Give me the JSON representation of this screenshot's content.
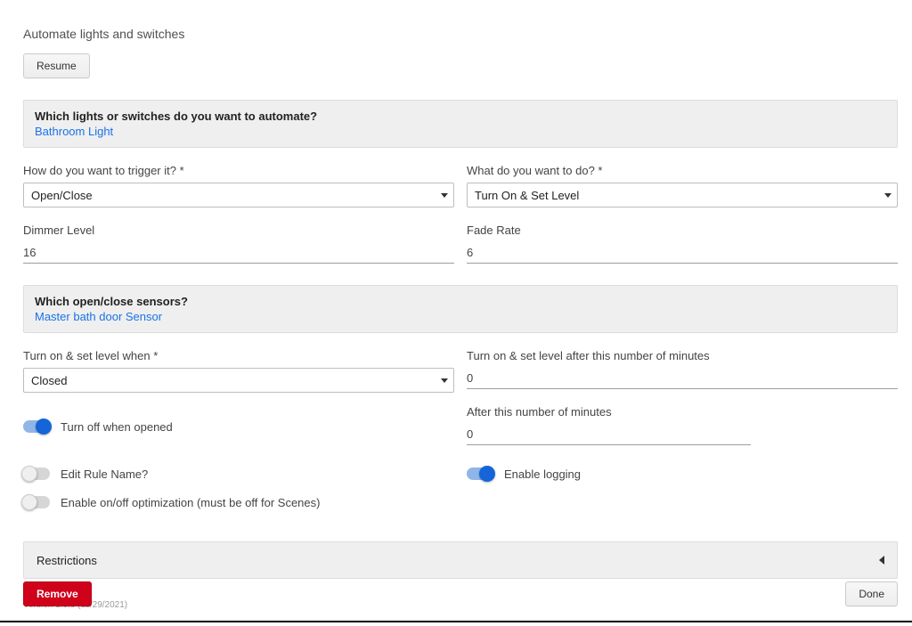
{
  "title": "Automate lights and switches",
  "resume_label": "Resume",
  "lights_panel": {
    "question": "Which lights or switches do you want to automate?",
    "selected": "Bathroom Light"
  },
  "trigger": {
    "label": "How do you want to trigger it? *",
    "value": "Open/Close"
  },
  "action": {
    "label": "What do you want to do? *",
    "value": "Turn On & Set Level"
  },
  "dimmer": {
    "label": "Dimmer Level",
    "value": "16"
  },
  "fade": {
    "label": "Fade Rate",
    "value": "6"
  },
  "sensors_panel": {
    "question": "Which open/close sensors?",
    "selected": "Master bath door Sensor"
  },
  "when": {
    "label": "Turn on & set level when *",
    "value": "Closed"
  },
  "delay": {
    "label": "Turn on & set level after this number of minutes",
    "value": "0"
  },
  "turnoff_opened": {
    "label": "Turn off when opened",
    "on": true
  },
  "after_minutes": {
    "label": "After this number of minutes",
    "value": "0"
  },
  "edit_name": {
    "label": "Edit Rule Name?",
    "on": false
  },
  "enable_logging": {
    "label": "Enable logging",
    "on": true
  },
  "enable_optimization": {
    "label": "Enable on/off optimization (must be off for Scenes)",
    "on": false
  },
  "restrictions_label": "Restrictions",
  "version": "Version 1.3.8 (11/29/2021)",
  "remove_label": "Remove",
  "done_label": "Done"
}
